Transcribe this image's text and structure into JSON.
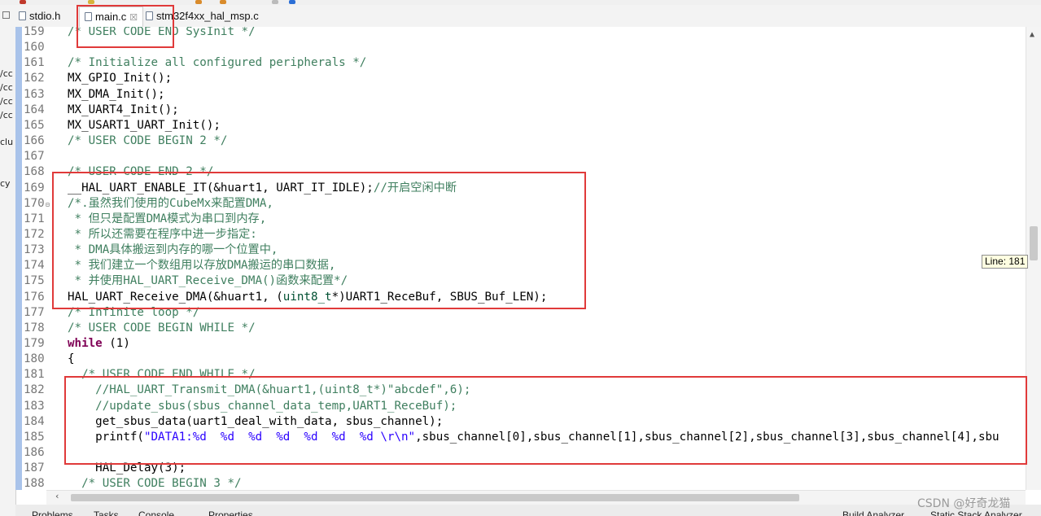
{
  "tabs": [
    {
      "label": "stdio.h",
      "active": false
    },
    {
      "label": "main.c",
      "active": true,
      "close": "☒"
    },
    {
      "label": "stm32f4xx_hal_msp.c",
      "active": false
    }
  ],
  "left_panel_fragments": [
    "/cc",
    "/cc",
    "/cc",
    "/cc",
    "clu",
    "cy"
  ],
  "tooltip": "Line: 181",
  "watermark": "CSDN @好奇龙猫",
  "bottom_tabs": [
    "Problems",
    "Tasks",
    "Console",
    "Properties",
    "Build Analyzer",
    "Static Stack Analyzer"
  ],
  "colors": {
    "highlight_box": "#e03a3a",
    "current_line": "#e8f2fe",
    "comment": "#3f7f5f",
    "keyword": "#7f0055",
    "string": "#2a00ff"
  },
  "code": [
    {
      "n": "159",
      "seg": [
        {
          "t": "/* USER CODE END SysInit */",
          "c": "cm"
        }
      ]
    },
    {
      "n": "160",
      "seg": []
    },
    {
      "n": "161",
      "seg": [
        {
          "t": "/* Initialize all configured peripherals */",
          "c": "cm"
        }
      ]
    },
    {
      "n": "162",
      "seg": [
        {
          "t": "MX_GPIO_Init();",
          "c": "code"
        }
      ]
    },
    {
      "n": "163",
      "seg": [
        {
          "t": "MX_DMA_Init();",
          "c": "code"
        }
      ]
    },
    {
      "n": "164",
      "seg": [
        {
          "t": "MX_UART4_Init();",
          "c": "code"
        }
      ]
    },
    {
      "n": "165",
      "seg": [
        {
          "t": "MX_USART1_UART_Init();",
          "c": "code"
        }
      ]
    },
    {
      "n": "166",
      "seg": [
        {
          "t": "/* USER CODE BEGIN 2 */",
          "c": "cm"
        }
      ]
    },
    {
      "n": "167",
      "seg": []
    },
    {
      "n": "168",
      "seg": [
        {
          "t": "/* USER CODE END 2 */",
          "c": "cm"
        }
      ]
    },
    {
      "n": "169",
      "seg": [
        {
          "t": "__HAL_UART_ENABLE_IT(&huart1, UART_IT_IDLE);",
          "c": "code"
        },
        {
          "t": "//开启空闲中断",
          "c": "cm"
        }
      ]
    },
    {
      "n": "170",
      "seg": [
        {
          "t": "/*.虽然我们使用的CubeMx来配置DMA,",
          "c": "cm"
        }
      ]
    },
    {
      "n": "171",
      "seg": [
        {
          "t": " * 但只是配置DMA模式为串口到内存,",
          "c": "cm"
        }
      ]
    },
    {
      "n": "172",
      "seg": [
        {
          "t": " * 所以还需要在程序中进一步指定:",
          "c": "cm"
        }
      ]
    },
    {
      "n": "173",
      "seg": [
        {
          "t": " * DMA具体搬运到内存的哪一个位置中,",
          "c": "cm"
        }
      ]
    },
    {
      "n": "174",
      "seg": [
        {
          "t": " * 我们建立一个数组用以存放DMA搬运的串口数据,",
          "c": "cm"
        }
      ]
    },
    {
      "n": "175",
      "seg": [
        {
          "t": " * 并使用HAL_UART_Receive_DMA()函数来配置*/",
          "c": "cm"
        }
      ]
    },
    {
      "n": "176",
      "seg": [
        {
          "t": "HAL_UART_Receive_DMA(&huart1, (",
          "c": "code"
        },
        {
          "t": "uint8_t",
          "c": "tp"
        },
        {
          "t": "*)UART1_ReceBuf, SBUS_Buf_LEN);",
          "c": "code"
        }
      ]
    },
    {
      "n": "177",
      "seg": [
        {
          "t": "/* Infinite loop */",
          "c": "cm"
        }
      ]
    },
    {
      "n": "178",
      "seg": [
        {
          "t": "/* USER CODE BEGIN WHILE */",
          "c": "cm"
        }
      ]
    },
    {
      "n": "179",
      "seg": [
        {
          "t": "while",
          "c": "kw"
        },
        {
          "t": " (1)",
          "c": "code"
        }
      ]
    },
    {
      "n": "180",
      "seg": [
        {
          "t": "{",
          "c": "code"
        }
      ]
    },
    {
      "n": "181",
      "seg": [
        {
          "t": "  /* USER CODE END WHILE */",
          "c": "cm"
        }
      ]
    },
    {
      "n": "182",
      "seg": [
        {
          "t": "    //HAL_UART_Transmit_DMA(&huart1,(uint8_t*)\"abcdef\",6);",
          "c": "cm"
        }
      ]
    },
    {
      "n": "183",
      "seg": [
        {
          "t": "    //update_sbus(sbus_channel_data_temp,UART1_ReceBuf);",
          "c": "cm"
        }
      ]
    },
    {
      "n": "184",
      "seg": [
        {
          "t": "    get_sbus_data(uart1_deal_with_data, sbus_channel);",
          "c": "code"
        }
      ]
    },
    {
      "n": "185",
      "seg": [
        {
          "t": "    printf(",
          "c": "code"
        },
        {
          "t": "\"DATA1:%d  %d  %d  %d  %d  %d  %d \\r\\n\"",
          "c": "str"
        },
        {
          "t": ",sbus_channel[0],sbus_channel[1],sbus_channel[2],sbus_channel[3],sbus_channel[4],sbu",
          "c": "code"
        }
      ]
    },
    {
      "n": "186",
      "seg": []
    },
    {
      "n": "187",
      "seg": [
        {
          "t": "    HAL_Delay(3);",
          "c": "code"
        }
      ]
    },
    {
      "n": "188",
      "seg": [
        {
          "t": "  /* USER CODE BEGIN 3 */",
          "c": "cm"
        }
      ]
    }
  ]
}
